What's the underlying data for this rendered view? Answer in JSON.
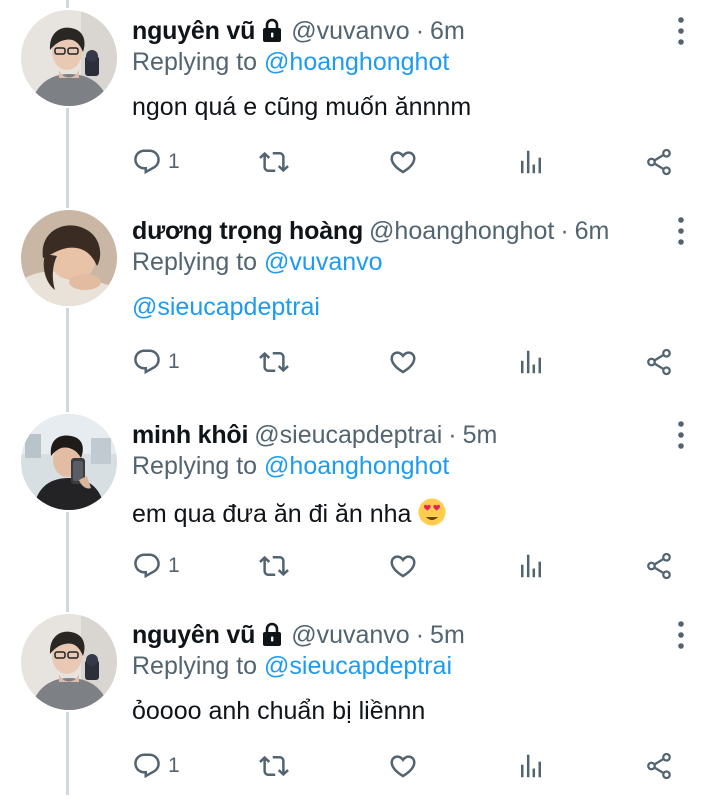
{
  "tweets": [
    {
      "name": "nguyên vũ",
      "locked": true,
      "handle": "@vuvanvo",
      "time": "6m",
      "replying_prefix": "Replying to",
      "replying_to": "@hoanghonghot",
      "text": "ngon quá e cũng muốn ănnnm",
      "text_is_mention": false,
      "reply_count": "1",
      "avatar_icon": "avatar-photo"
    },
    {
      "name": "dương trọng hoàng",
      "locked": false,
      "handle": "@hoanghonghot",
      "time": "6m",
      "replying_prefix": "Replying to",
      "replying_to": "@vuvanvo",
      "text": "@sieucapdeptrai",
      "text_is_mention": true,
      "reply_count": "1",
      "avatar_icon": "avatar-photo"
    },
    {
      "name": "minh khôi",
      "locked": false,
      "handle": "@sieucapdeptrai",
      "time": "5m",
      "replying_prefix": "Replying to",
      "replying_to": "@hoanghonghot",
      "text": "em qua đưa ăn đi ăn nha",
      "text_is_mention": false,
      "emoji": "heart-eyes-emoji",
      "reply_count": "1",
      "avatar_icon": "avatar-photo"
    },
    {
      "name": "nguyên vũ",
      "locked": true,
      "handle": "@vuvanvo",
      "time": "5m",
      "replying_prefix": "Replying to",
      "replying_to": "@sieucapdeptrai",
      "text": "ỏoooo anh chuẩn bị liềnnn",
      "text_is_mention": false,
      "reply_count": "1",
      "avatar_icon": "avatar-photo"
    }
  ],
  "colors": {
    "link": "#1d9bf0",
    "secondary_text": "#536471",
    "thread_line": "#cfd9de"
  },
  "icons": {
    "reply": "reply-icon",
    "retweet": "retweet-icon",
    "like": "heart-icon",
    "views": "analytics-icon",
    "share": "share-icon",
    "more": "more-vertical-icon",
    "lock": "lock-icon"
  }
}
